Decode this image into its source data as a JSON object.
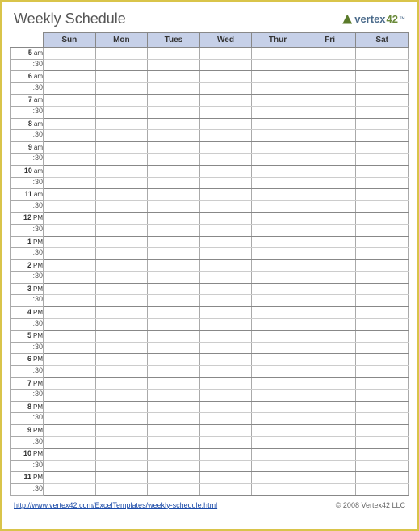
{
  "title": "Weekly Schedule",
  "logo": {
    "text": "vertex",
    "num": "42",
    "tm": "™"
  },
  "days": [
    "Sun",
    "Mon",
    "Tues",
    "Wed",
    "Thur",
    "Fri",
    "Sat"
  ],
  "half_label": ":30",
  "hours": [
    {
      "h": "5",
      "p": "am"
    },
    {
      "h": "6",
      "p": "am"
    },
    {
      "h": "7",
      "p": "am"
    },
    {
      "h": "8",
      "p": "am"
    },
    {
      "h": "9",
      "p": "am"
    },
    {
      "h": "10",
      "p": "am"
    },
    {
      "h": "11",
      "p": "am"
    },
    {
      "h": "12",
      "p": "PM"
    },
    {
      "h": "1",
      "p": "PM"
    },
    {
      "h": "2",
      "p": "PM"
    },
    {
      "h": "3",
      "p": "PM"
    },
    {
      "h": "4",
      "p": "PM"
    },
    {
      "h": "5",
      "p": "PM"
    },
    {
      "h": "6",
      "p": "PM"
    },
    {
      "h": "7",
      "p": "PM"
    },
    {
      "h": "8",
      "p": "PM"
    },
    {
      "h": "9",
      "p": "PM"
    },
    {
      "h": "10",
      "p": "PM"
    },
    {
      "h": "11",
      "p": "PM"
    }
  ],
  "footer": {
    "link": "http://www.vertex42.com/ExcelTemplates/weekly-schedule.html",
    "copyright": "© 2008 Vertex42 LLC"
  }
}
